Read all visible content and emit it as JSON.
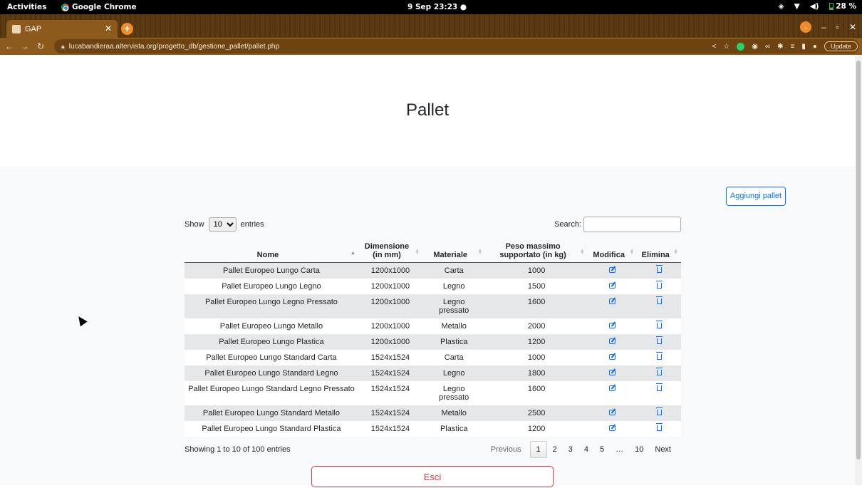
{
  "system_bar": {
    "activities": "Activities",
    "app_name": "Google Chrome",
    "clock": "9 Sep 23:23  ●",
    "battery": "28 %"
  },
  "browser": {
    "tab_title": "GAP",
    "url": "lucabandieraa.altervista.org/progetto_db/gestione_pallet/pallet.php",
    "update_label": "Update"
  },
  "page": {
    "title": "Pallet",
    "add_button": "Aggiungi pallet",
    "exit_button": "Esci"
  },
  "datatable": {
    "show_label": "Show",
    "entries_label": "entries",
    "length_value": "10",
    "search_label": "Search:",
    "search_value": "",
    "columns": [
      "Nome",
      "Dimensione (in mm)",
      "Materiale",
      "Peso massimo supportato (in kg)",
      "Modifica",
      "Elimina"
    ],
    "rows": [
      {
        "nome": "Pallet Europeo Lungo Carta",
        "dimensione": "1200x1000",
        "materiale": "Carta",
        "peso": "1000"
      },
      {
        "nome": "Pallet Europeo Lungo Legno",
        "dimensione": "1200x1000",
        "materiale": "Legno",
        "peso": "1500"
      },
      {
        "nome": "Pallet Europeo Lungo Legno Pressato",
        "dimensione": "1200x1000",
        "materiale": "Legno pressato",
        "peso": "1600"
      },
      {
        "nome": "Pallet Europeo Lungo Metallo",
        "dimensione": "1200x1000",
        "materiale": "Metallo",
        "peso": "2000"
      },
      {
        "nome": "Pallet Europeo Lungo Plastica",
        "dimensione": "1200x1000",
        "materiale": "Plastica",
        "peso": "1200"
      },
      {
        "nome": "Pallet Europeo Lungo Standard Carta",
        "dimensione": "1524x1524",
        "materiale": "Carta",
        "peso": "1000"
      },
      {
        "nome": "Pallet Europeo Lungo Standard Legno",
        "dimensione": "1524x1524",
        "materiale": "Legno",
        "peso": "1800"
      },
      {
        "nome": "Pallet Europeo Lungo Standard Legno Pressato",
        "dimensione": "1524x1524",
        "materiale": "Legno pressato",
        "peso": "1600"
      },
      {
        "nome": "Pallet Europeo Lungo Standard Metallo",
        "dimensione": "1524x1524",
        "materiale": "Metallo",
        "peso": "2500"
      },
      {
        "nome": "Pallet Europeo Lungo Standard Plastica",
        "dimensione": "1524x1524",
        "materiale": "Plastica",
        "peso": "1200"
      }
    ],
    "info": "Showing 1 to 10 of 100 entries",
    "pagination": {
      "previous": "Previous",
      "pages": [
        "1",
        "2",
        "3",
        "4",
        "5",
        "…",
        "10"
      ],
      "next": "Next"
    }
  }
}
